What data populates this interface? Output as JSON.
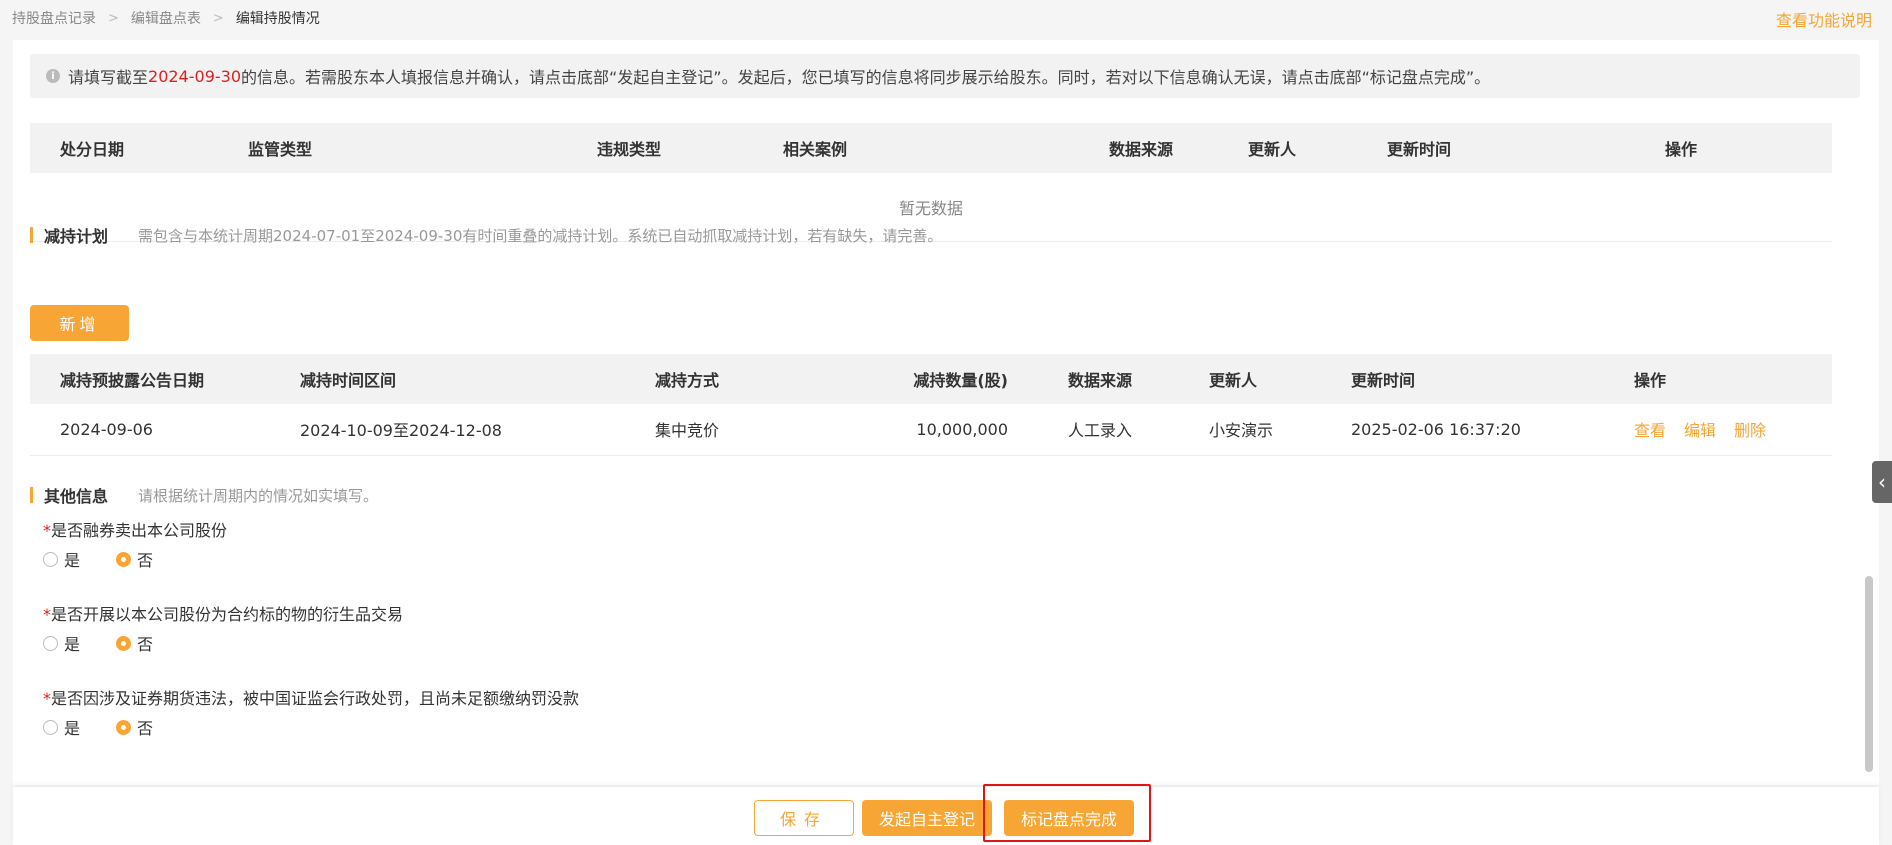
{
  "breadcrumb": [
    "持股盘点记录",
    "编辑盘点表",
    "编辑持股情况"
  ],
  "help_link": "查看功能说明",
  "notice": {
    "prefix": "请填写截至",
    "date": "2024-09-30",
    "suffix": "的信息。若需股东本人填报信息并确认，请点击底部“发起自主登记”。发起后，您已填写的信息将同步展示给股东。同时，若对以下信息确认无误，请点击底部“标记盘点完成”。"
  },
  "penalty_table": {
    "headers": [
      "处分日期",
      "监管类型",
      "违规类型",
      "相关案例",
      "数据来源",
      "更新人",
      "更新时间",
      "操作"
    ],
    "empty_text": "暂无数据"
  },
  "reduction": {
    "title": "减持计划",
    "desc": "需包含与本统计周期2024-07-01至2024-09-30有时间重叠的减持计划。系统已自动抓取减持计划，若有缺失，请完善。",
    "add_label": "新增",
    "headers": [
      "减持预披露公告日期",
      "减持时间区间",
      "减持方式",
      "减持数量(股)",
      "数据来源",
      "更新人",
      "更新时间",
      "操作"
    ],
    "rows": [
      {
        "date": "2024-09-06",
        "range": "2024-10-09至2024-12-08",
        "method": "集中竞价",
        "qty": "10,000,000",
        "source": "人工录入",
        "updater": "小安演示",
        "updated": "2025-02-06 16:37:20",
        "ops": [
          "查看",
          "编辑",
          "删除"
        ]
      }
    ]
  },
  "other": {
    "title": "其他信息",
    "desc": "请根据统计周期内的情况如实填写。",
    "questions": [
      {
        "star": "*",
        "text": "是否融券卖出本公司股份",
        "yes": "是",
        "no": "否",
        "selected": "no"
      },
      {
        "star": "*",
        "text": "是否开展以本公司股份为合约标的物的衍生品交易",
        "yes": "是",
        "no": "否",
        "selected": "no"
      },
      {
        "star": "*",
        "text": "是否因涉及证券期货违法，被中国证监会行政处罚，且尚未足额缴纳罚没款",
        "yes": "是",
        "no": "否",
        "selected": "no"
      }
    ]
  },
  "footer": {
    "save": "保存",
    "start_self_register": "发起自主登记",
    "mark_done": "标记盘点完成"
  },
  "colors": {
    "accent": "#f7a535",
    "alert": "#e02020",
    "highlight_box": "#e01515"
  }
}
